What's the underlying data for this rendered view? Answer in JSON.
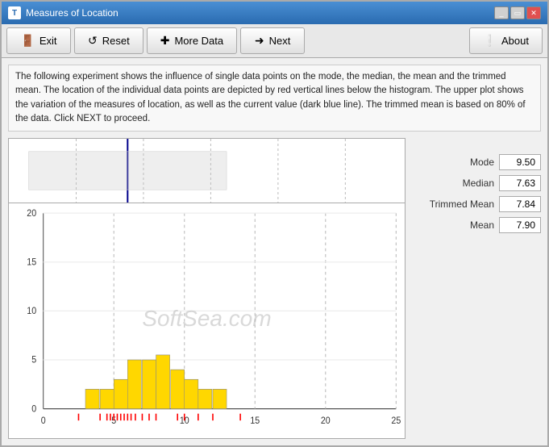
{
  "window": {
    "title": "Measures of Location",
    "icon_label": "T"
  },
  "title_controls": {
    "minimize": "_",
    "restore": "▭",
    "close": "✕"
  },
  "toolbar": {
    "exit_label": "Exit",
    "reset_label": "Reset",
    "more_data_label": "More Data",
    "next_label": "Next",
    "about_label": "About"
  },
  "description": "The following experiment shows the influence of single data points on the mode, the median, the mean and the trimmed mean. The location of the individual data points are depicted by red vertical lines below the histogram. The upper plot shows the variation of the measures of location, as well as the current value (dark blue line). The trimmed mean is based on 80% of the data. Click NEXT to proceed.",
  "stats": {
    "mode_label": "Mode",
    "mode_value": "9.50",
    "median_label": "Median",
    "median_value": "7.63",
    "trimmed_mean_label": "Trimmed Mean",
    "trimmed_mean_value": "7.84",
    "mean_label": "Mean",
    "mean_value": "7.90"
  },
  "watermark": "SoftSea.com",
  "chart": {
    "x_labels": [
      "0",
      "5",
      "10",
      "15",
      "20",
      "25"
    ],
    "y_labels": [
      "0",
      "5",
      "10",
      "15",
      "20"
    ],
    "bars": [
      {
        "x": 3,
        "height": 2
      },
      {
        "x": 4,
        "height": 2
      },
      {
        "x": 5,
        "height": 3
      },
      {
        "x": 6,
        "height": 5
      },
      {
        "x": 7,
        "height": 5
      },
      {
        "x": 8,
        "height": 5
      },
      {
        "x": 9,
        "height": 4
      },
      {
        "x": 10,
        "height": 3
      },
      {
        "x": 11,
        "height": 2
      },
      {
        "x": 12,
        "height": 2
      }
    ],
    "red_marks": [
      2.5,
      3,
      4,
      4.5,
      5,
      5.5,
      5.8,
      6,
      6.2,
      6.5,
      6.8,
      7,
      7.5,
      8,
      9,
      9.5,
      10,
      11,
      12,
      14
    ]
  }
}
